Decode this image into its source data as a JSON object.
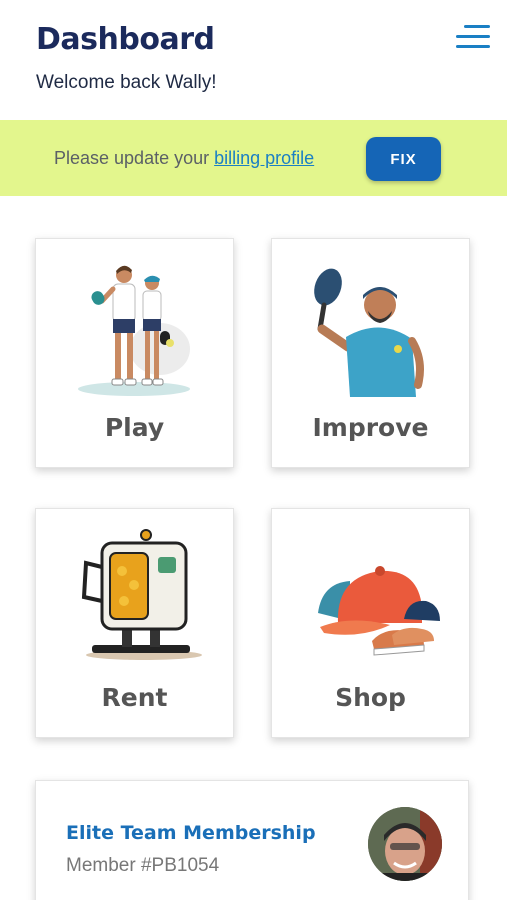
{
  "header": {
    "title": "Dashboard",
    "subtitle": "Welcome back Wally!",
    "menu_icon": "hamburger-menu-icon"
  },
  "banner": {
    "text_before": "Please update your ",
    "link_text": "billing profile",
    "button_label": "FIX",
    "background_color": "#e3f68d",
    "button_color": "#1565b6"
  },
  "cards": [
    {
      "label": "Play",
      "illustration": "pickleball-couple-illustration"
    },
    {
      "label": "Improve",
      "illustration": "player-with-paddle-illustration"
    },
    {
      "label": "Rent",
      "illustration": "ball-machine-illustration"
    },
    {
      "label": "Shop",
      "illustration": "cap-and-shoes-illustration"
    }
  ],
  "membership": {
    "title": "Elite Team Membership",
    "member_number": "Member #PB1054",
    "avatar": "user-avatar-photo"
  },
  "colors": {
    "title": "#1b2a5c",
    "accent": "#1a7fc4",
    "card_label": "#555555"
  }
}
